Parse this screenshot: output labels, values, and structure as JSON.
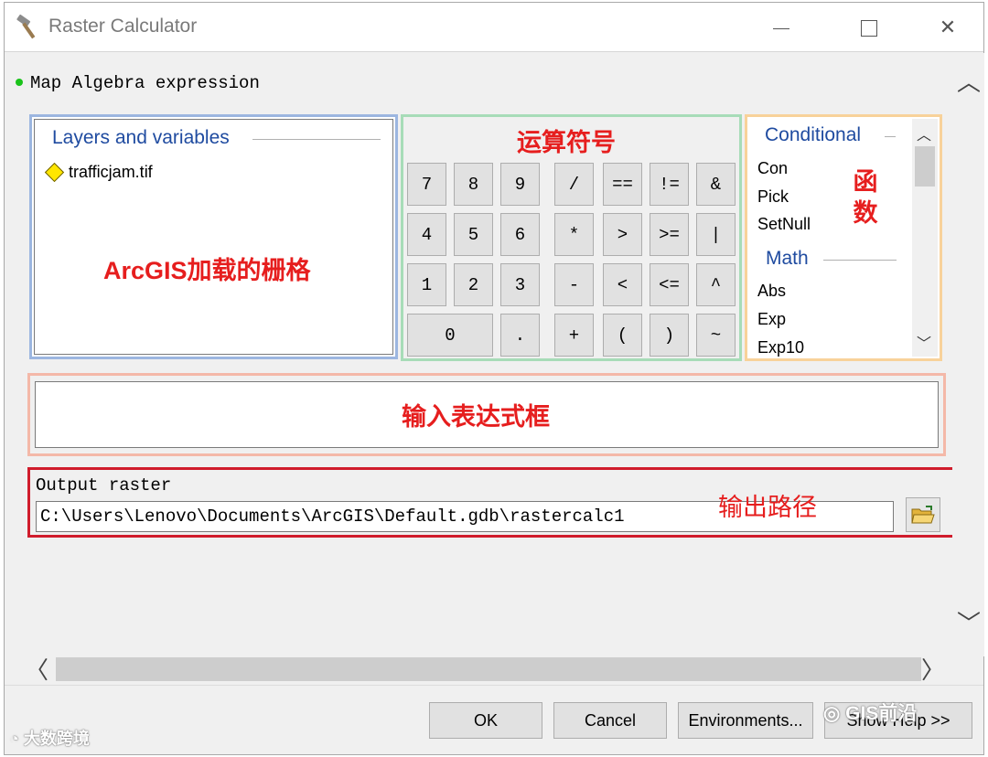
{
  "window": {
    "title": "Raster Calculator",
    "close_glyph": "✕"
  },
  "expression_label": "Map Algebra expression",
  "layers": {
    "title": "Layers and variables",
    "items": [
      "trafficjam.tif"
    ],
    "annotation": "ArcGIS加载的栅格"
  },
  "operators": {
    "annotation": "运算符号",
    "rows": [
      [
        "7",
        "8",
        "9",
        "/",
        "==",
        "!=",
        "&"
      ],
      [
        "4",
        "5",
        "6",
        "*",
        ">",
        ">=",
        "|"
      ],
      [
        "1",
        "2",
        "3",
        "-",
        "<",
        "<=",
        "^"
      ],
      [
        "0",
        ".",
        "+",
        "(",
        ")",
        "~"
      ]
    ]
  },
  "functions": {
    "annotation": "函数",
    "groups": [
      {
        "title": "Conditional",
        "items": [
          "Con",
          "Pick",
          "SetNull"
        ]
      },
      {
        "title": "Math",
        "items": [
          "Abs",
          "Exp",
          "Exp10"
        ]
      }
    ]
  },
  "expression_box": {
    "value": "",
    "annotation": "输入表达式框"
  },
  "output": {
    "label": "Output raster",
    "value": "C:\\Users\\Lenovo\\Documents\\ArcGIS\\Default.gdb\\rastercalc1",
    "annotation": "输出路径"
  },
  "buttons": {
    "ok": "OK",
    "cancel": "Cancel",
    "environments": "Environments...",
    "show_help": "Show Help >>"
  },
  "watermarks": {
    "left": "大数跨境",
    "right": "GIS前沿"
  }
}
